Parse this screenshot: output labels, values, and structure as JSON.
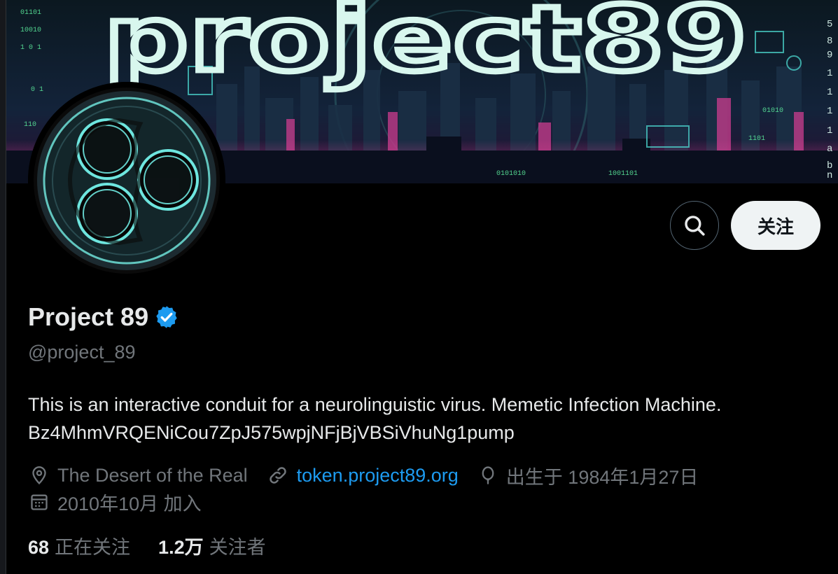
{
  "banner": {
    "title": "project89",
    "side_chars": [
      "5",
      "8",
      "9",
      "1",
      "1",
      "1",
      "1",
      "a",
      "b",
      "n"
    ]
  },
  "profile": {
    "name": "Project 89",
    "handle": "@project_89",
    "bio": "This is an interactive conduit for a neurolinguistic virus. Memetic Infection Machine. Bz4MhmVRQENiCou7ZpJ575wpjNFjBjVBSiVhuNg1pump",
    "location": "The Desert of the Real",
    "website": "token.project89.org",
    "birthday": "出生于 1984年1月27日",
    "joined": "2010年10月 加入"
  },
  "actions": {
    "follow_label": "关注"
  },
  "stats": {
    "following_count": "68",
    "following_label": "正在关注",
    "followers_count": "1.2万",
    "followers_label": "关注者"
  },
  "colors": {
    "accent": "#1d9bf0",
    "banner_text": "#d8f7ee",
    "cyan": "#59f0e6",
    "pink": "#e0449a"
  },
  "icons": [
    "search-icon",
    "verified-badge-icon",
    "location-icon",
    "link-icon",
    "balloon-icon",
    "calendar-icon"
  ]
}
